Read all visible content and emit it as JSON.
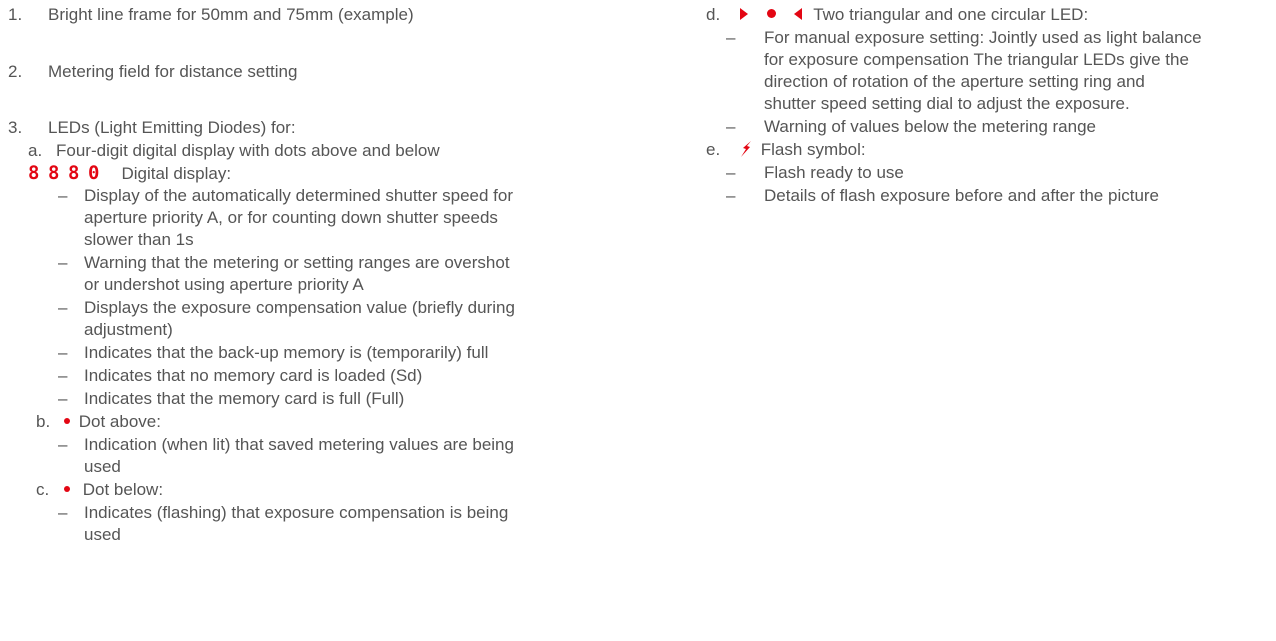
{
  "items": {
    "i1": {
      "num": "1.",
      "text": "Bright line frame for 50mm and 75mm (example)"
    },
    "i2": {
      "num": "2.",
      "text": "Metering field for distance setting"
    },
    "i3": {
      "num": "3.",
      "text": "LEDs (Light Emitting Diodes) for:"
    }
  },
  "sub_a": {
    "letter": "a.",
    "text": "Four-digit digital display with dots above and below",
    "digits": [
      "8",
      "8",
      "8",
      "0"
    ],
    "display_label": "Digital display:",
    "bullets": [
      [
        "Display of the automatically determined shutter speed for",
        "aperture priority A, or for counting down shutter speeds",
        "slower than 1s"
      ],
      [
        "Warning that the metering or setting ranges are overshot",
        "or undershot using aperture priority A"
      ],
      [
        "Displays the exposure compensation value (briefly during",
        "adjustment)"
      ],
      [
        "Indicates that the back-up memory is (temporarily) full"
      ],
      [
        "Indicates that no memory card is loaded (Sd)"
      ],
      [
        "Indicates that the memory card is full (Full)"
      ]
    ]
  },
  "sub_b": {
    "letter": "b.",
    "label": "Dot above:",
    "bullets": [
      [
        "Indication (when lit) that saved metering values are being",
        "used"
      ]
    ]
  },
  "sub_c": {
    "letter": "c.",
    "label": "Dot below:",
    "bullets": [
      [
        "Indicates (flashing) that exposure compensation is being",
        "used"
      ]
    ]
  },
  "sub_d": {
    "letter": "d.",
    "label": "Two triangular and one circular LED:",
    "bullets": [
      [
        "For manual exposure setting: Jointly used as light balance",
        "for exposure compensation The triangular LEDs give the",
        "direction of rotation of the aperture setting ring and",
        "shutter speed setting dial to adjust the exposure."
      ],
      [
        "Warning of values below the metering range"
      ]
    ]
  },
  "sub_e": {
    "letter": "e.",
    "label": "Flash symbol:",
    "bullets": [
      [
        "Flash ready to use"
      ],
      [
        "Details of flash exposure before and after the picture"
      ]
    ]
  },
  "dash": "–",
  "colors": {
    "text": "#555555",
    "led": "#e30613"
  }
}
